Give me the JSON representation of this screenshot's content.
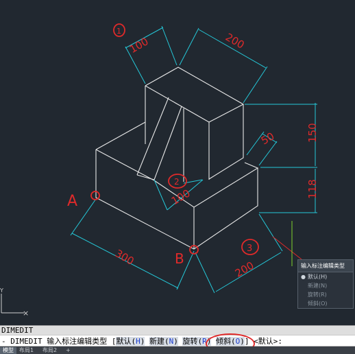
{
  "drawing": {
    "dimensions": {
      "top_left": "100",
      "top_right": "200",
      "right_upper": "150",
      "right_lower": "118",
      "notch": "50",
      "inner": "100",
      "bottom_left": "300",
      "bottom_right": "200"
    },
    "annotations": {
      "point_a": "A",
      "point_b": "B",
      "circle_1": "1",
      "circle_2": "2",
      "circle_3": "3"
    },
    "ucs_y": "Y",
    "colors": {
      "dimension": "#25c8d8",
      "annotation": "#e02a2a",
      "geometry": "#e8e8e8",
      "guide": "#7ed32b"
    }
  },
  "popup_menu": {
    "title": "输入标注编辑类型",
    "items": [
      {
        "label": "默认(H)",
        "selected": true
      },
      {
        "label": "新建(N)",
        "selected": false
      },
      {
        "label": "旋转(R)",
        "selected": false
      },
      {
        "label": "倾斜(O)",
        "selected": false
      }
    ]
  },
  "command": {
    "history": "DIMEDIT",
    "prompt_prefix": "- DIMEDIT 输入标注编辑类型 [",
    "options": [
      {
        "text": "默认(",
        "key": "H",
        "close": ")"
      },
      {
        "text": "新建(",
        "key": "N",
        "close": ")"
      },
      {
        "text": "旋转(",
        "key": "R",
        "close": ")"
      },
      {
        "text": "倾斜(",
        "key": "O",
        "close": ")"
      }
    ],
    "prompt_suffix": "] <默认>:"
  },
  "tabs": [
    "模型",
    "布局1",
    "布局2",
    "+"
  ]
}
